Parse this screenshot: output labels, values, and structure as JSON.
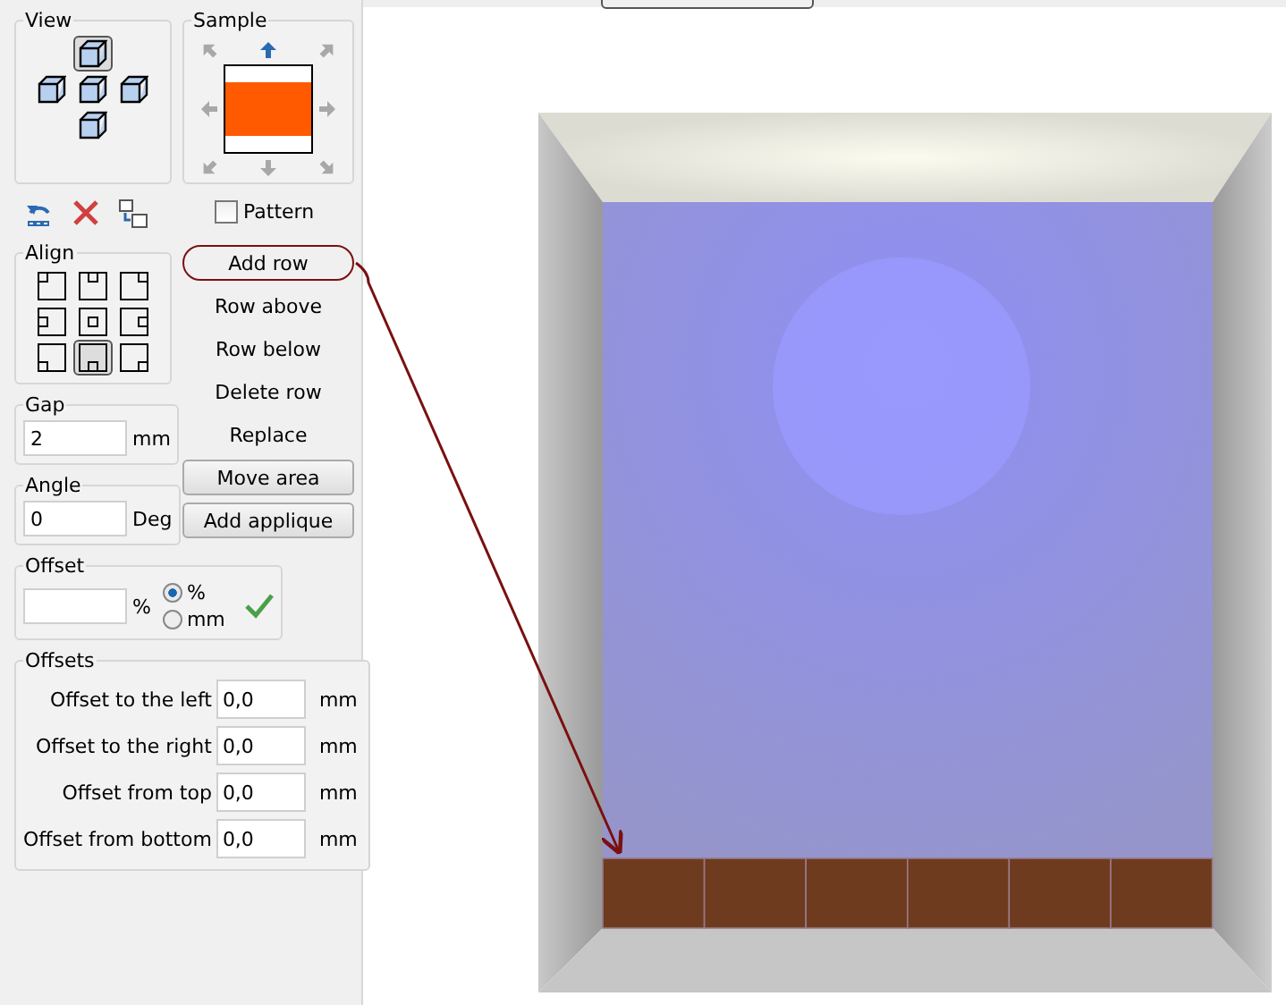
{
  "view": {
    "title": "View",
    "cubes": [
      {
        "selected": true
      },
      {
        "selected": false
      },
      {
        "selected": false
      },
      {
        "selected": false
      },
      {
        "selected": false
      }
    ]
  },
  "sample": {
    "title": "Sample",
    "arrows": [
      {
        "selected": false
      },
      {
        "selected": true
      },
      {
        "selected": false
      },
      {
        "selected": false
      },
      {
        "selected": false
      },
      {
        "selected": false
      },
      {
        "selected": false
      },
      {
        "selected": false
      }
    ]
  },
  "pattern": {
    "label": "Pattern",
    "checked": false
  },
  "align": {
    "title": "Align",
    "cells": [
      {
        "selected": false
      },
      {
        "selected": false
      },
      {
        "selected": false
      },
      {
        "selected": false
      },
      {
        "selected": false
      },
      {
        "selected": false
      },
      {
        "selected": false
      },
      {
        "selected": true
      },
      {
        "selected": false
      }
    ]
  },
  "actions": [
    {
      "label": "Add row",
      "kind": "flat",
      "circled": true
    },
    {
      "label": "Row above",
      "kind": "flat",
      "circled": false
    },
    {
      "label": "Row below",
      "kind": "flat",
      "circled": false
    },
    {
      "label": "Delete row",
      "kind": "flat",
      "circled": false
    },
    {
      "label": "Replace",
      "kind": "flat",
      "circled": false
    },
    {
      "label": "Move area",
      "kind": "raised",
      "circled": false
    },
    {
      "label": "Add applique",
      "kind": "raised",
      "circled": false
    }
  ],
  "gap": {
    "title": "Gap",
    "value": "2",
    "unit": "mm"
  },
  "angle": {
    "title": "Angle",
    "value": "0",
    "unit": "Deg"
  },
  "offset": {
    "title": "Offset",
    "unit": "%",
    "options": [
      {
        "label": "%",
        "selected": true
      },
      {
        "label": "mm",
        "selected": false
      }
    ]
  },
  "offsets": {
    "title": "Offsets",
    "rows": [
      {
        "label": "Offset to the left",
        "value": "0,0",
        "unit": "mm"
      },
      {
        "label": "Offset to the right",
        "value": "0,0",
        "unit": "mm"
      },
      {
        "label": "Offset from top",
        "value": "0,0",
        "unit": "mm"
      },
      {
        "label": "Offset from bottom",
        "value": "0,0",
        "unit": "mm"
      }
    ]
  }
}
